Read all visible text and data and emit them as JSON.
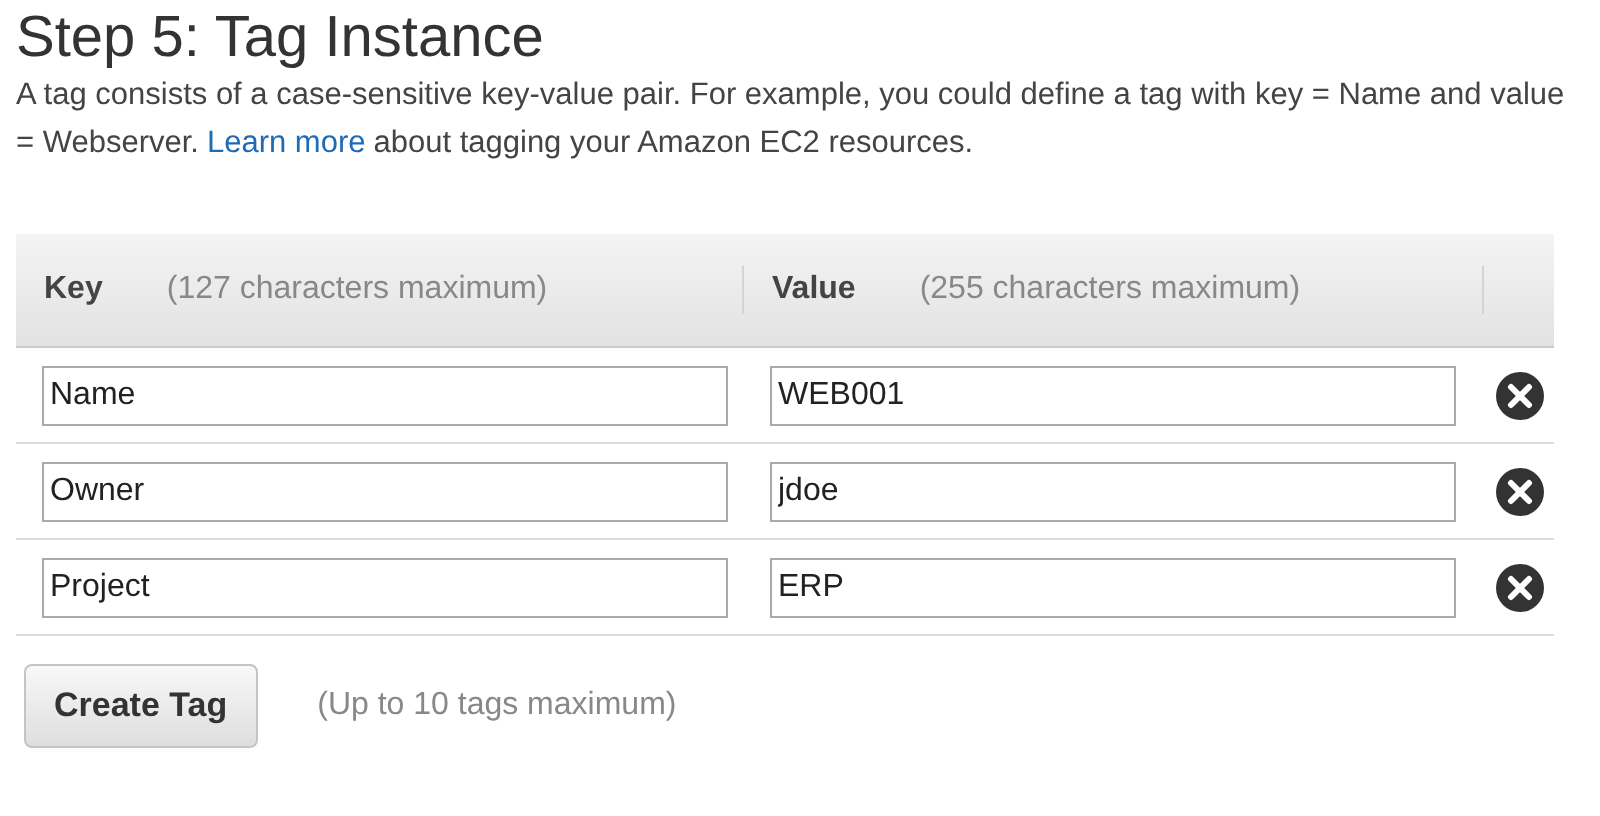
{
  "title": "Step 5: Tag Instance",
  "description": {
    "before": "A tag consists of a case-sensitive key-value pair. For example, you could define a tag with key = Name and value = Webserver.",
    "link": "Learn more",
    "after": "about tagging your Amazon EC2 resources."
  },
  "table": {
    "columns": [
      {
        "label": "Key",
        "hint": "(127 characters maximum)"
      },
      {
        "label": "Value",
        "hint": "(255 characters maximum)"
      }
    ],
    "rows": [
      {
        "key": "Name",
        "value": "WEB001"
      },
      {
        "key": "Owner",
        "value": "jdoe"
      },
      {
        "key": "Project",
        "value": "ERP"
      }
    ]
  },
  "create_button": "Create Tag",
  "limit_note": "(Up to 10 tags maximum)"
}
